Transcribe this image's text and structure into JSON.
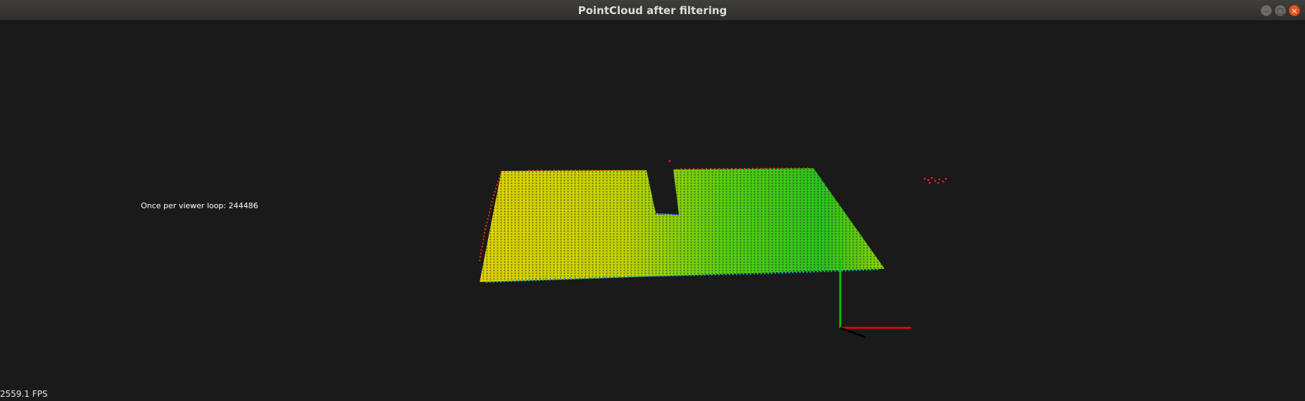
{
  "window": {
    "title": "PointCloud after filtering",
    "controls": {
      "minimize": "–",
      "maximize": "□",
      "close": "×"
    }
  },
  "viewer": {
    "overlay_text": "Once per viewer loop: 244486",
    "fps_text": "2559.1 FPS",
    "background_color": "#1a1a1a",
    "axes": {
      "x_color": "#ff0000",
      "y_color": "#00d000",
      "z_color": "#000000"
    },
    "cloud_colors": [
      "#d8d000",
      "#b8d800",
      "#60d800",
      "#20c020",
      "#ff2000",
      "#10b8c0"
    ]
  }
}
